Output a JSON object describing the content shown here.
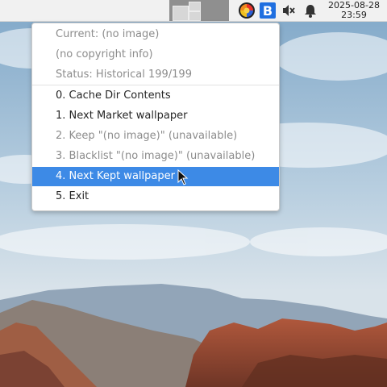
{
  "panel": {
    "clock_date": "2025-08-28",
    "clock_time": "23:59",
    "tray_b_label": "B",
    "icons": [
      "workspace-pager",
      "color-wheel-icon",
      "bing-wallpaper-icon",
      "volume-muted-icon",
      "notification-bell-icon"
    ]
  },
  "menu": {
    "info": [
      "Current: (no image)",
      "(no copyright info)",
      "Status: Historical 199/199"
    ],
    "items": [
      {
        "label": "0. Cache Dir Contents",
        "state": "enabled"
      },
      {
        "label": "1. Next Market wallpaper",
        "state": "enabled"
      },
      {
        "label": "2. Keep \"(no image)\" (unavailable)",
        "state": "disabled"
      },
      {
        "label": "3. Blacklist \"(no image)\" (unavailable)",
        "state": "disabled"
      },
      {
        "label": "4. Next Kept wallpaper",
        "state": "selected"
      },
      {
        "label": "5. Exit",
        "state": "enabled"
      }
    ]
  },
  "colors": {
    "selection": "#3d8ae6",
    "disabled_text": "#8c8c8c",
    "sky": "#8fb3d0",
    "rock": "#9a4a33"
  }
}
